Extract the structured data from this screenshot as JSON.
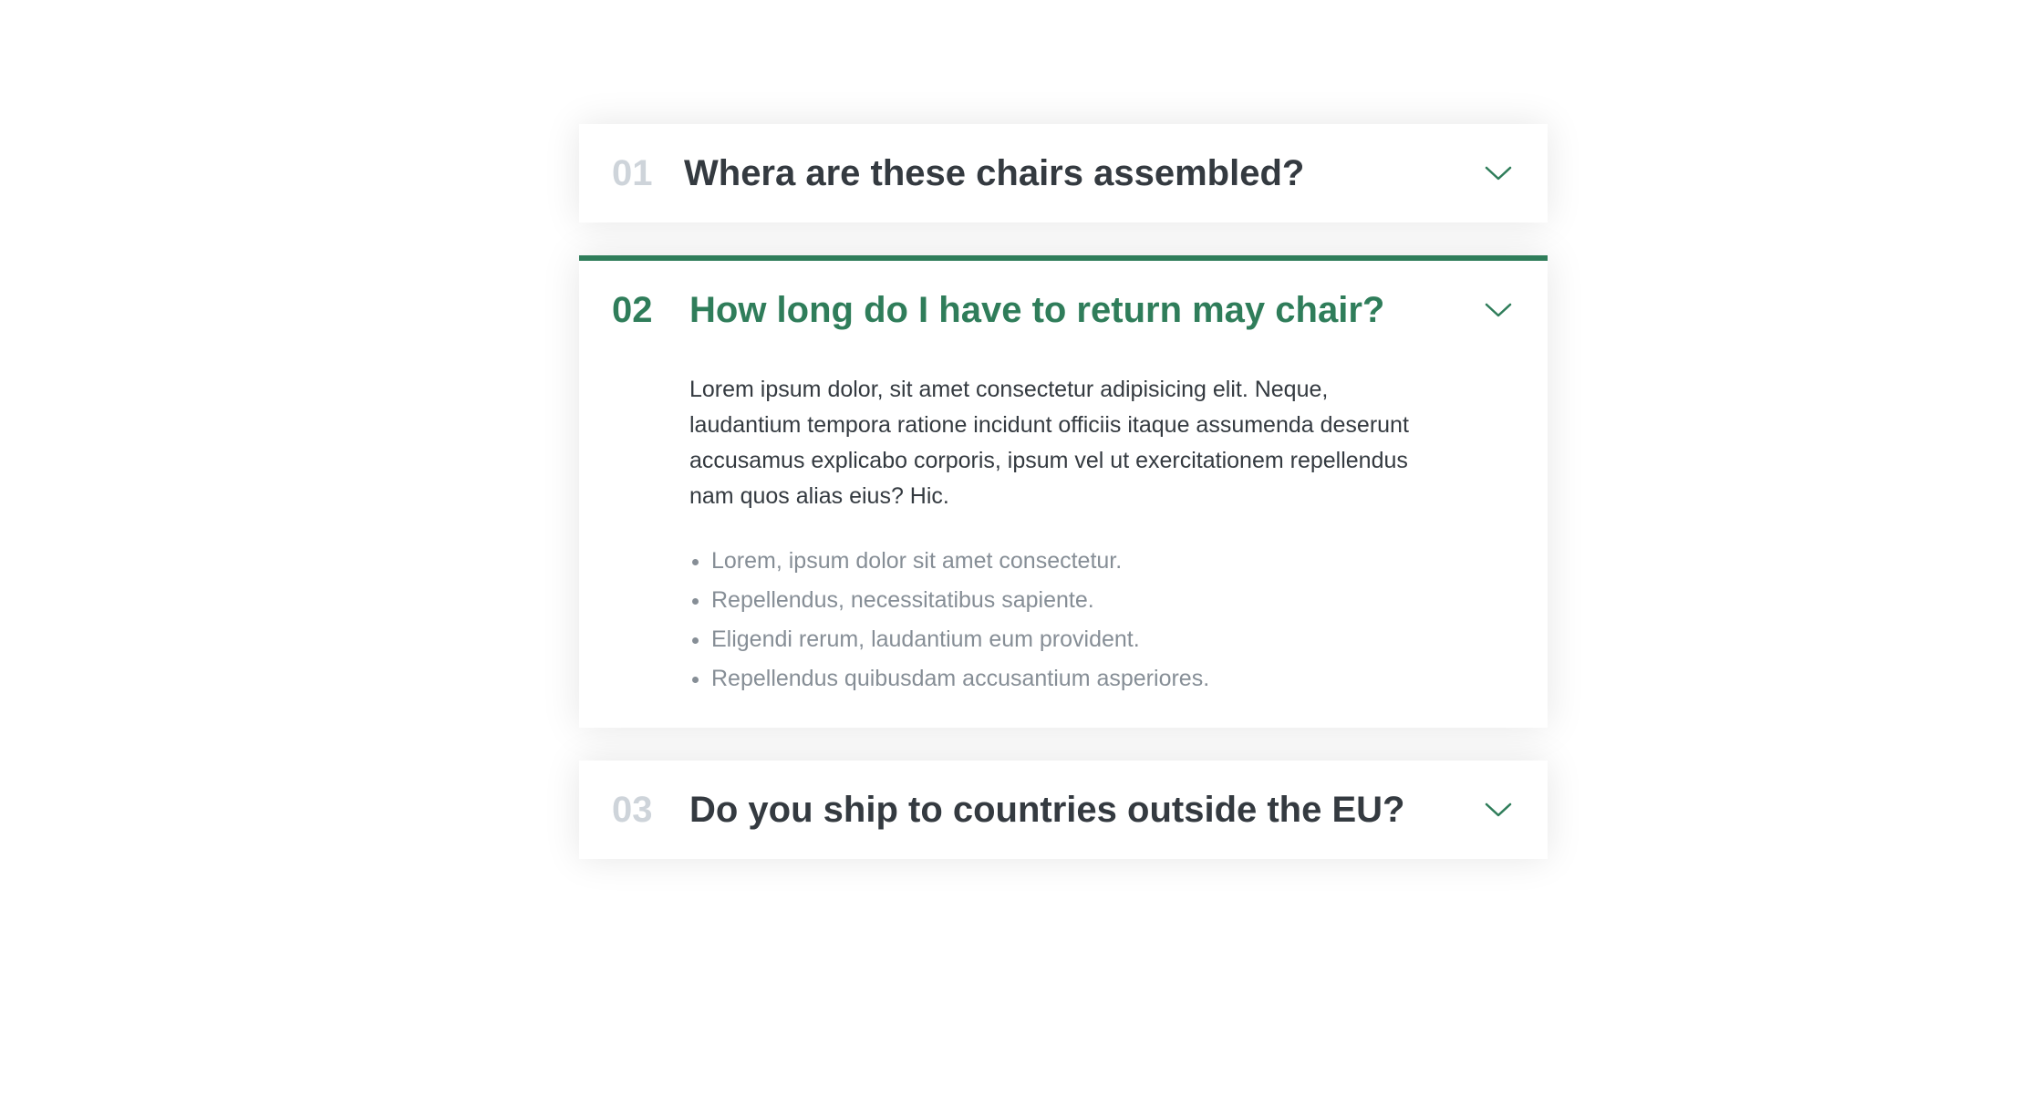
{
  "colors": {
    "accent": "#2f7d5a",
    "muted_number": "#ced4da",
    "heading": "#343a40",
    "list_text": "#868e96"
  },
  "faq": {
    "items": [
      {
        "number": "01",
        "question": "Whera are these chairs assembled?",
        "icon": "chevron-down-icon"
      },
      {
        "number": "02",
        "question": "How long do I have to return may chair?",
        "icon": "chevron-down-icon",
        "answer": "Lorem ipsum dolor, sit amet consectetur adipisicing elit. Neque, laudantium tempora ratione incidunt officiis itaque assumenda deserunt accusamus explicabo corporis, ipsum vel ut exercitationem repellendus nam quos alias eius? Hic.",
        "list": [
          "Lorem, ipsum dolor sit amet consectetur.",
          "Repellendus, necessitatibus sapiente.",
          "Eligendi rerum, laudantium eum provident.",
          "Repellendus quibusdam accusantium asperiores."
        ]
      },
      {
        "number": "03",
        "question": "Do you ship to countries outside the EU?",
        "icon": "chevron-down-icon"
      }
    ]
  }
}
